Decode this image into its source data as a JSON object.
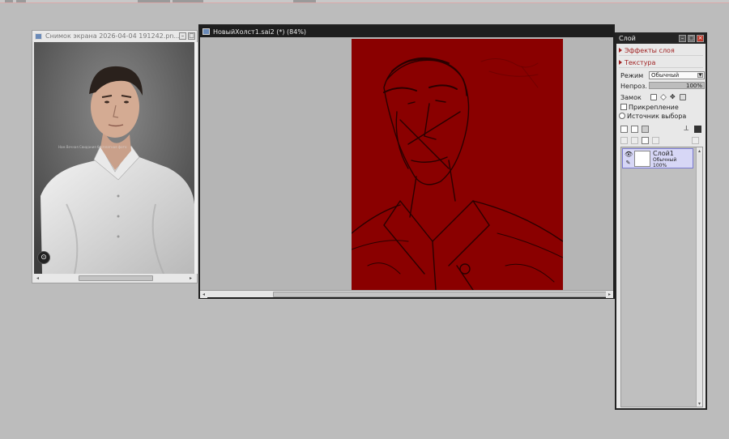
{
  "photo_window": {
    "title": "Снимок экрана 2026-04-04 191242.pn...",
    "watermark": "Нам Вечная Свидания бесплатная фото"
  },
  "canvas_window": {
    "title": "НовыйХолст1.sai2 (*) (84%)"
  },
  "layer_panel": {
    "title": "Слой",
    "sections": [
      "Эффекты слоя",
      "Текстура"
    ],
    "mode_label": "Режим",
    "mode_value": "Обычный",
    "opacity_label": "Непроз.",
    "opacity_value": "100%",
    "opacity_fraction": 1.0,
    "lock_label": "Замок",
    "clip_label": "Прикрепление",
    "source_label": "Источник выбора",
    "layers": [
      {
        "name": "Слой1",
        "mode": "Обычный",
        "opacity": "100%"
      }
    ]
  },
  "icons": {
    "close": "close-icon",
    "maximize": "maximize-icon",
    "minimize": "minimize-icon",
    "eye": "eye-icon",
    "pen": "pen-icon"
  },
  "colors": {
    "canvas_red": "#8a0000",
    "layer_selected": "#d7d7f6",
    "section_text": "#a02222"
  }
}
